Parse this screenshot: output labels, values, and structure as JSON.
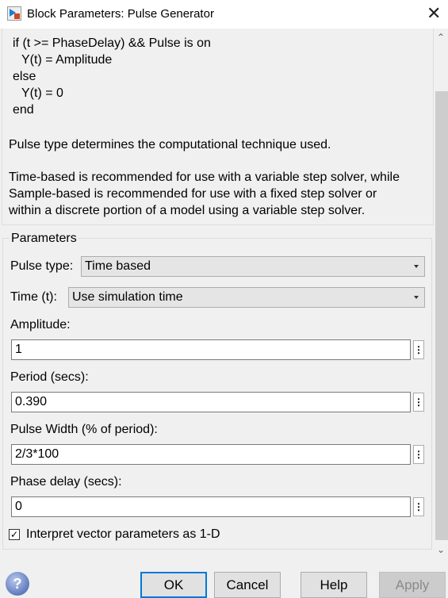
{
  "window": {
    "title": "Block Parameters: Pulse Generator",
    "close_icon": "close-icon"
  },
  "description": {
    "code": [
      "if (t >= PhaseDelay) && Pulse is on",
      "  Y(t) = Amplitude",
      "else",
      "  Y(t) = 0",
      "end"
    ],
    "para1": "Pulse type determines the computational technique used.",
    "para2": [
      "Time-based is recommended for use with a variable step solver, while",
      "Sample-based is recommended for use with a fixed step solver or",
      "within a discrete portion of a model using a variable step solver."
    ]
  },
  "parameters": {
    "group_label": "Parameters",
    "pulse_type": {
      "label": "Pulse type:",
      "value": "Time based"
    },
    "time": {
      "label": "Time (t):",
      "value": "Use simulation time"
    },
    "amplitude": {
      "label": "Amplitude:",
      "value": "1"
    },
    "period": {
      "label": "Period (secs):",
      "value": "0.390"
    },
    "pulse_width": {
      "label": "Pulse Width (% of period):",
      "value": "2/3*100"
    },
    "phase_delay": {
      "label": "Phase delay (secs):",
      "value": "0"
    },
    "interpret_vector": {
      "label": "Interpret vector parameters as 1-D",
      "checked": true
    }
  },
  "buttons": {
    "ok": "OK",
    "cancel": "Cancel",
    "help": "Help",
    "apply": "Apply"
  },
  "colors": {
    "ok_border": "#0078d7",
    "disabled_text": "#8a8a8a"
  }
}
